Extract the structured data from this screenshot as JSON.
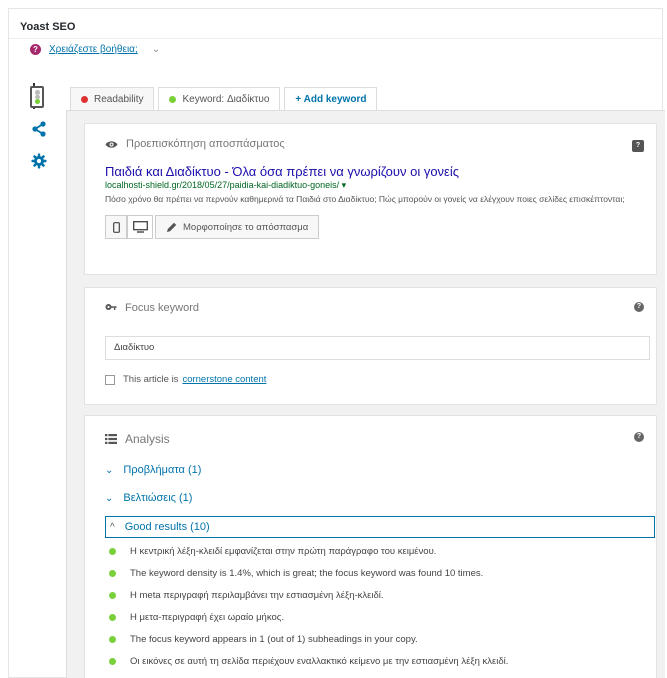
{
  "header": {
    "title": "Yoast SEO"
  },
  "help": {
    "link_text": "Χρειάζεστε βοήθεια;",
    "chevron": "⌄"
  },
  "tabs": [
    {
      "label": "Readability",
      "dot_color": "#dc3232"
    },
    {
      "label": "Keyword: Διαδίκτυο",
      "dot_color": "#7ad03a"
    },
    {
      "label": "+ Add keyword"
    }
  ],
  "snippet": {
    "section_title": "Προεπισκόπηση αποσπάσματος",
    "title": "Παιδιά και Διαδίκτυο - Όλα όσα πρέπει να γνωρίζουν οι γονείς",
    "url": "localhosti-shield.gr/2018/05/27/paidia-kai-diadiktuo-goneis/ ▾",
    "description": "Πόσο χρόνο θα πρέπει να περνούν καθημερινά τα Παιδιά στο Διαδίκτυο; Πώς μπορούν οι γονείς να ελέγχουν ποιες σελίδες επισκέπτονται;",
    "edit_label": "Μορφοποίησε το απόσπασμα"
  },
  "focus": {
    "section_title": "Focus keyword",
    "input_value": "Διαδίκτυο",
    "cornerstone_prefix": "This article is",
    "cornerstone_link": "cornerstone content"
  },
  "analysis": {
    "section_title": "Analysis",
    "problems_label": "Προβλήματα (1)",
    "improvements_label": "Βελτιώσεις (1)",
    "good_label": "Good results (10)",
    "results": [
      "Η κεντρική λέξη-κλειδί εμφανίζεται στην πρώτη παράγραφο του κειμένου.",
      "The keyword density is 1.4%, which is great; the focus keyword was found 10 times.",
      "Η meta περιγραφή περιλαμβάνει την εστιασμένη λέξη-κλειδί.",
      "Η μετα-περιγραφή έχει ωραίο μήκος.",
      "The focus keyword appears in 1 (out of 1) subheadings in your copy.",
      "Οι εικόνες σε αυτή τη σελίδα περιέχουν εναλλακτικό κείμενο με την εστιασμένη λέξη κλειδί."
    ]
  },
  "colors": {
    "link": "#0073aa",
    "good": "#7ad03a",
    "bad": "#dc3232",
    "yoast_purple": "#a4286a"
  }
}
